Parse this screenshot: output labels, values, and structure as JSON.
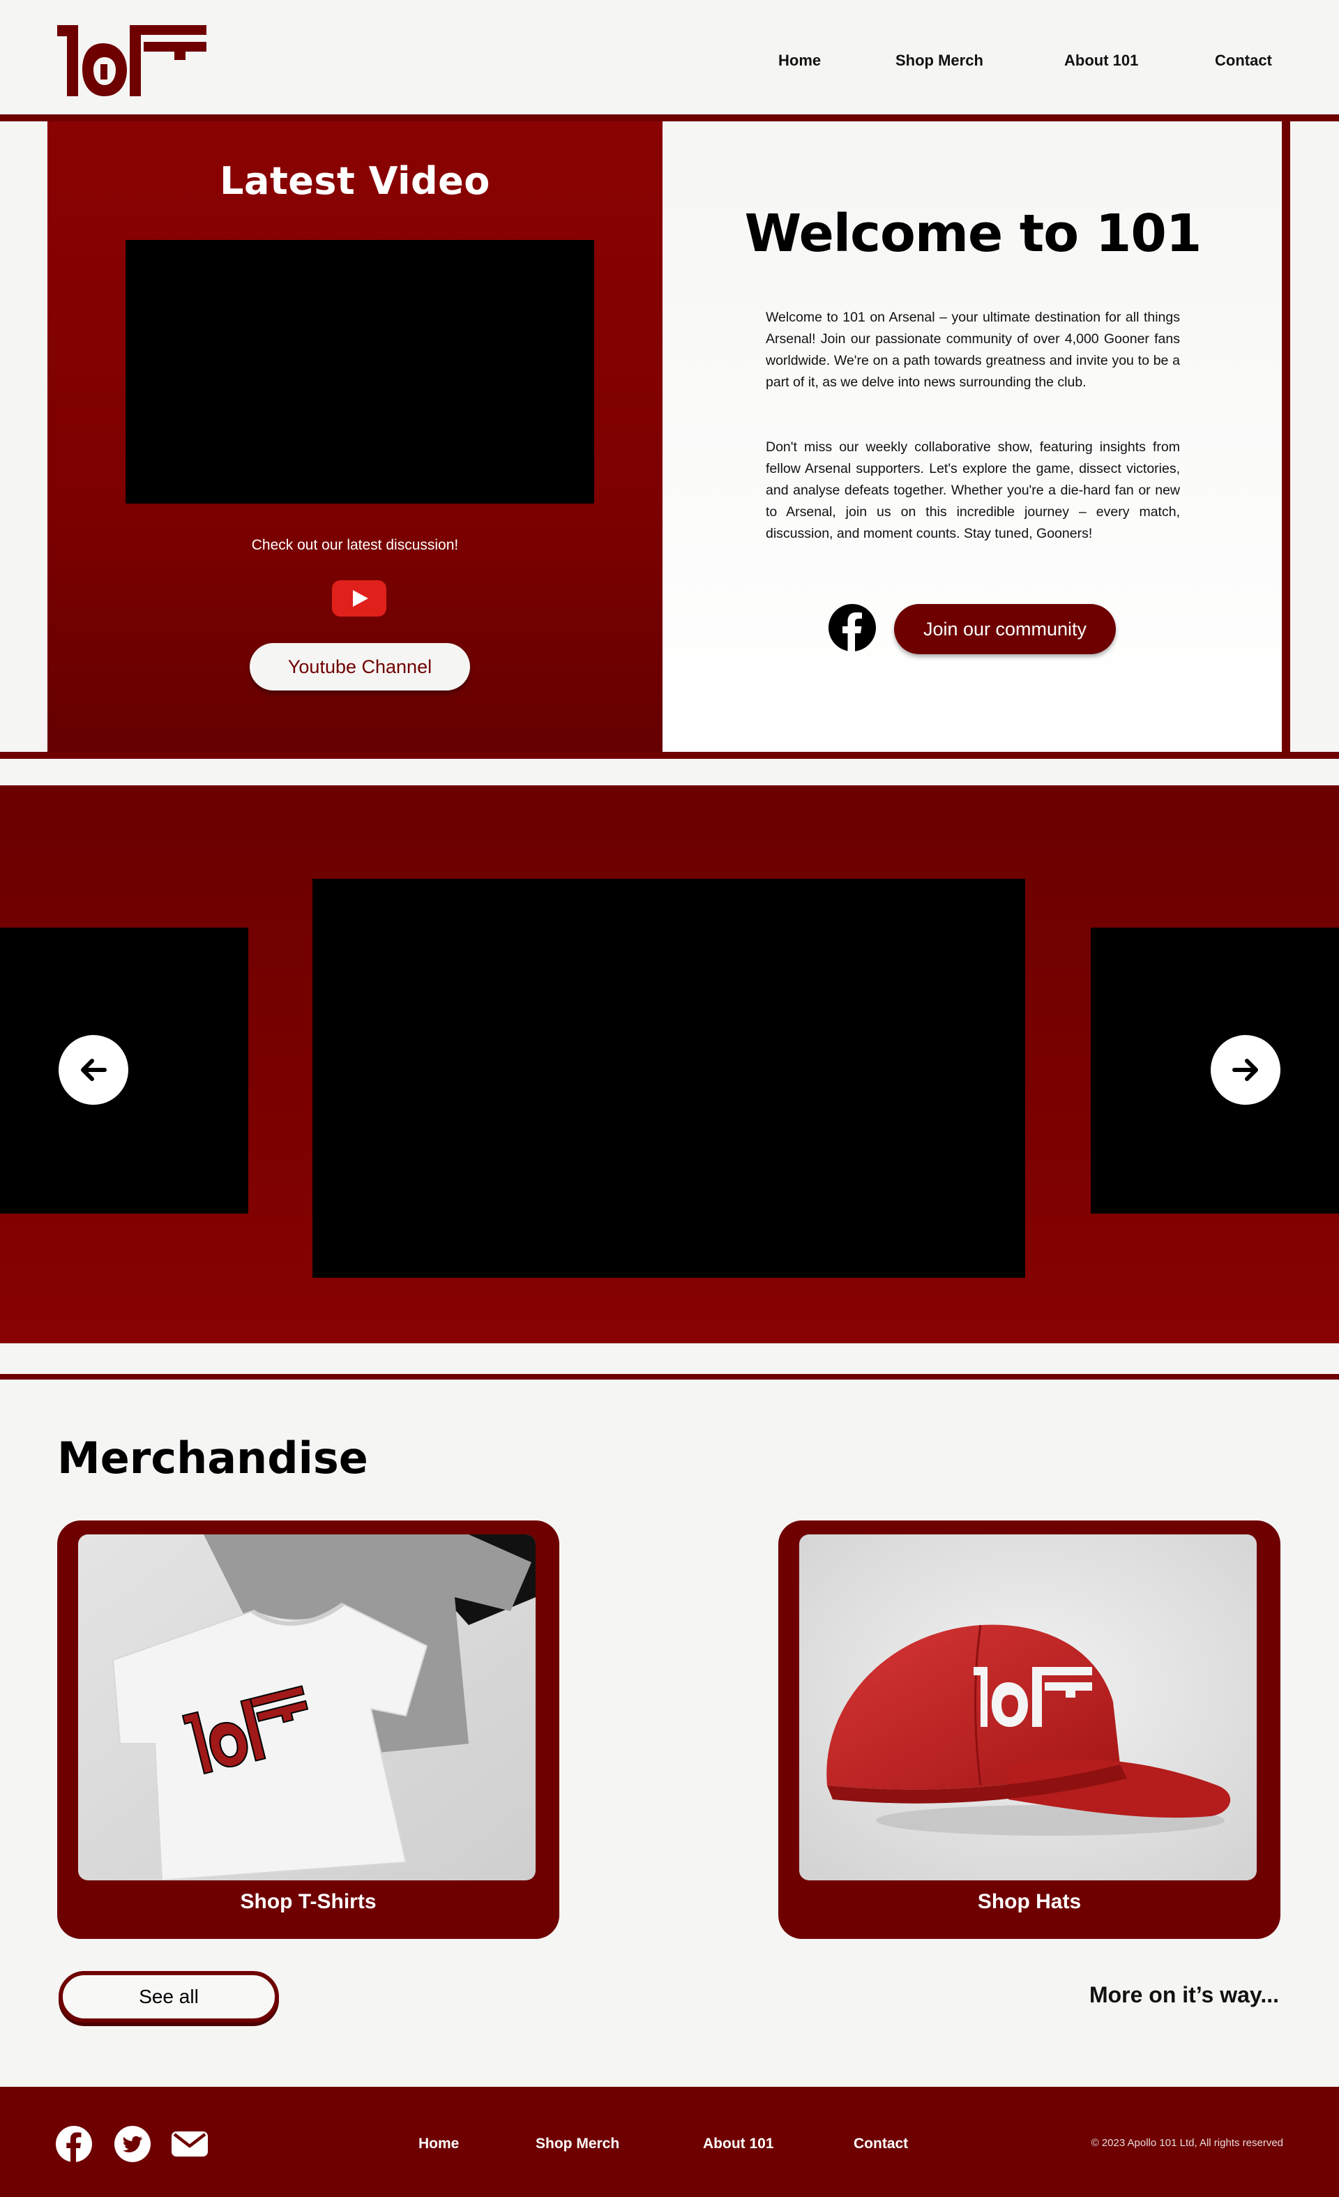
{
  "header": {
    "logo_text": "101",
    "nav": [
      "Home",
      "Shop Merch",
      "About 101",
      "Contact"
    ]
  },
  "hero": {
    "latest_title": "Latest Video",
    "latest_caption": "Check out our latest discussion!",
    "youtube_button": "Youtube Channel",
    "welcome_title": "Welcome to 101",
    "welcome_paragraphs": [
      "Welcome to 101 on Arsenal – your ultimate destination for all things Arsenal! Join our passionate community of over 4,000 Gooner fans worldwide. We're on a path towards greatness and invite you to be a part of it, as we delve into news surrounding the club.",
      "Don't miss our weekly collaborative show, featuring insights from fellow Arsenal supporters. Let's explore the game, dissect victories, and analyse defeats together. Whether you're a die-hard fan or new to Arsenal, join us on this incredible journey – every match, discussion, and moment counts. Stay tuned, Gooners!"
    ],
    "join_button": "Join our community"
  },
  "carousel": {
    "prev_icon": "arrow-left-icon",
    "next_icon": "arrow-right-icon"
  },
  "merch": {
    "title": "Merchandise",
    "cards": [
      {
        "label": "Shop T-Shirts",
        "image": "t-shirt-mockup"
      },
      {
        "label": "Shop Hats",
        "image": "red-cap-mockup"
      }
    ],
    "see_all": "See all",
    "more_soon": "More on it’s way..."
  },
  "footer": {
    "social_icons": [
      "facebook-icon",
      "twitter-icon",
      "email-icon"
    ],
    "nav": [
      "Home",
      "Shop Merch",
      "About 101",
      "Contact"
    ],
    "copyright": "© 2023 Apollo 101 Ltd, All rights reserved"
  },
  "colors": {
    "brand": "#6e0000",
    "brand_light": "#8a0202",
    "background": "#f5f5f3"
  }
}
